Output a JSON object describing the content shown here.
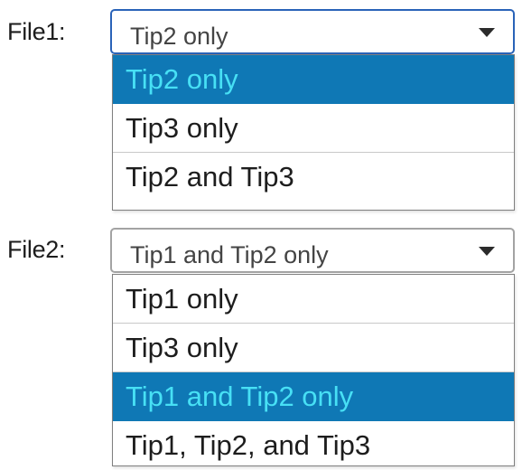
{
  "dropdowns": [
    {
      "label": "File1:",
      "selected_value": "Tip2 only",
      "options": [
        {
          "label": "Tip2 only",
          "selected": true
        },
        {
          "label": "Tip3 only",
          "selected": false
        },
        {
          "label": "Tip2 and Tip3",
          "selected": false
        }
      ]
    },
    {
      "label": "File2:",
      "selected_value": "Tip1 and Tip2 only",
      "options": [
        {
          "label": "Tip1 only",
          "selected": false
        },
        {
          "label": "Tip3 only",
          "selected": false
        },
        {
          "label": "Tip1 and Tip2 only",
          "selected": true
        },
        {
          "label": "Tip1, Tip2, and Tip3",
          "selected": false
        }
      ]
    }
  ],
  "icons": {
    "dropdown_arrow": "chevron-down-icon"
  },
  "colors": {
    "highlight_bg": "#0f78b5",
    "highlight_text": "#47e0f5",
    "focus_border": "#2a63b8"
  }
}
